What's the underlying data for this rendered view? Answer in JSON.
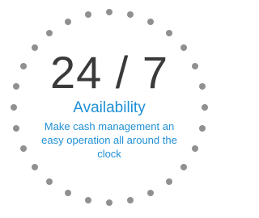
{
  "badge": {
    "headline": "24 / 7",
    "subtitle": "Availability",
    "description": "Make cash management an easy operation all around the clock"
  },
  "colors": {
    "headline": "#3a3a3a",
    "accent": "#1f8fd6",
    "dots": "#909090"
  }
}
